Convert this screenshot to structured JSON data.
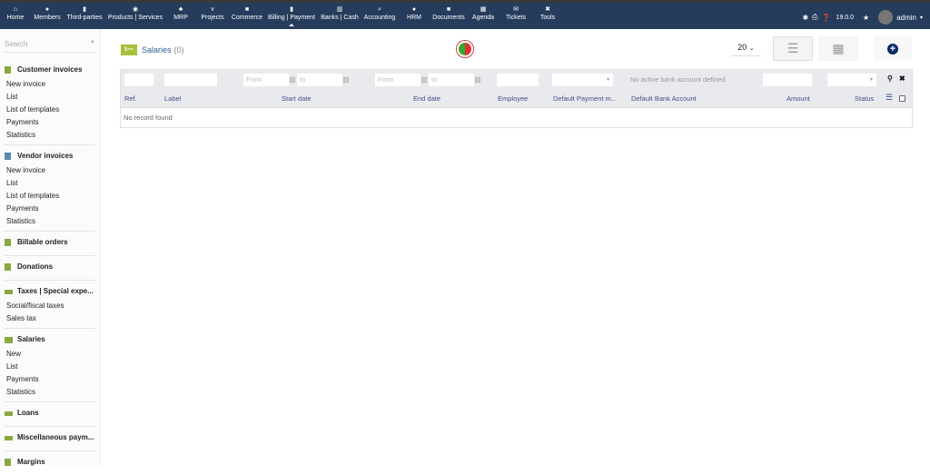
{
  "topnav": {
    "items": [
      {
        "label": "Home",
        "icon": "home-icon",
        "glyph": "⌂"
      },
      {
        "label": "Members",
        "icon": "user-icon",
        "glyph": "●"
      },
      {
        "label": "Third-parties",
        "icon": "building-icon",
        "glyph": "▮"
      },
      {
        "label": "Products | Services",
        "icon": "cube-icon",
        "glyph": "◉"
      },
      {
        "label": "MRP",
        "icon": "cubes-icon",
        "glyph": "♣"
      },
      {
        "label": "Projects",
        "icon": "sitemap-icon",
        "glyph": "⋎"
      },
      {
        "label": "Commerce",
        "icon": "suitcase-icon",
        "glyph": "■"
      },
      {
        "label": "Billing | Payment",
        "icon": "invoice-icon",
        "glyph": "▮"
      },
      {
        "label": "Banks | Cash",
        "icon": "bank-icon",
        "glyph": "▥"
      },
      {
        "label": "Accounting",
        "icon": "search-dollar-icon",
        "glyph": "⌕"
      },
      {
        "label": "HRM",
        "icon": "user-tie-icon",
        "glyph": "●"
      },
      {
        "label": "Documents",
        "icon": "folder-icon",
        "glyph": "■"
      },
      {
        "label": "Agenda",
        "icon": "calendar-icon",
        "glyph": "▦"
      },
      {
        "label": "Tickets",
        "icon": "envelope-icon",
        "glyph": "✉"
      },
      {
        "label": "Tools",
        "icon": "tools-icon",
        "glyph": "✖"
      }
    ],
    "version": "19.0.0",
    "user": "admin"
  },
  "sidebar": {
    "search_placeholder": "Search",
    "sections": [
      {
        "title": "Customer invoices",
        "items": [
          "New invoice",
          "List",
          "List of templates",
          "Payments",
          "Statistics"
        ]
      },
      {
        "title": "Vendor invoices",
        "items": [
          "New invoice",
          "List",
          "List of templates",
          "Payments",
          "Statistics"
        ]
      },
      {
        "title": "Billable orders",
        "items": []
      },
      {
        "title": "Donations",
        "items": []
      },
      {
        "title": "Taxes | Special expe...",
        "items": [
          "Social/fiscal taxes",
          "Sales tax"
        ]
      },
      {
        "title": "Salaries",
        "items": [
          "New",
          "List",
          "Payments",
          "Statistics"
        ]
      },
      {
        "title": "Loans",
        "items": []
      },
      {
        "title": "Miscellaneous paym...",
        "items": []
      },
      {
        "title": "Margins",
        "items": []
      }
    ]
  },
  "page": {
    "title": "Salaries",
    "count": "(0)",
    "page_size": "20"
  },
  "table": {
    "filters": {
      "from": "From",
      "to": "to",
      "no_bank": "No active bank account defined"
    },
    "columns": [
      "Ref.",
      "Label",
      "Start date",
      "End date",
      "Employee",
      "Default Payment m...",
      "Default Bank Account",
      "Amount",
      "Status"
    ],
    "empty": "No record found"
  },
  "colors": {
    "topbar": "#263c5c",
    "accent": "#a8bf3a",
    "header_text": "#4a4a8a"
  }
}
